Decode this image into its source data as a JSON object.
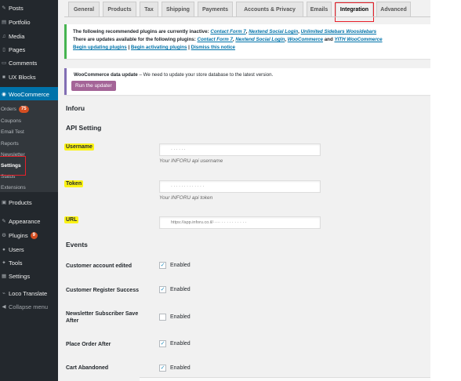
{
  "sidebar": {
    "items": [
      {
        "label": "Posts",
        "icon": "pin-icon"
      },
      {
        "label": "Portfolio",
        "icon": "portfolio-icon"
      },
      {
        "label": "Media",
        "icon": "media-icon"
      },
      {
        "label": "Pages",
        "icon": "pages-icon"
      },
      {
        "label": "Comments",
        "icon": "comments-icon"
      },
      {
        "label": "UX Blocks",
        "icon": "blocks-icon"
      },
      {
        "label": "WooCommerce",
        "icon": "woo-icon"
      },
      {
        "label": "Products",
        "icon": "products-icon"
      },
      {
        "label": "Appearance",
        "icon": "appearance-icon"
      },
      {
        "label": "Plugins",
        "icon": "plugins-icon",
        "badge": "9"
      },
      {
        "label": "Users",
        "icon": "users-icon"
      },
      {
        "label": "Tools",
        "icon": "tools-icon"
      },
      {
        "label": "Settings",
        "icon": "settings-icon"
      },
      {
        "label": "Loco Translate",
        "icon": "translate-icon"
      },
      {
        "label": "Collapse menu",
        "icon": "collapse-icon"
      }
    ],
    "sub_items": [
      {
        "label": "Orders",
        "badge": "75"
      },
      {
        "label": "Coupons"
      },
      {
        "label": "Email Test"
      },
      {
        "label": "Reports"
      },
      {
        "label": "Newsletter"
      },
      {
        "label": "Settings"
      },
      {
        "label": "Status"
      },
      {
        "label": "Extensions"
      }
    ]
  },
  "tabs": [
    "General",
    "Products",
    "Tax",
    "Shipping",
    "Payments",
    "Accounts & Privacy",
    "Emails",
    "Integration",
    "Advanced"
  ],
  "active_tab": "Integration",
  "notice_plugins": {
    "line1_prefix": "The following recommended plugins are currently inactive: ",
    "line1_links": [
      "Contact Form 7",
      "Nextend Social Login",
      "Unlimited Sidebars Woosidebars"
    ],
    "line2_prefix": "There are updates available for the following plugins: ",
    "line2_links": [
      "Contact Form 7",
      "Nextend Social Login",
      "WooCommerce",
      "YITH WooCommerce"
    ],
    "line3_links": [
      "Begin updating plugins",
      "Begin activating plugins",
      "Dismiss this notice"
    ],
    "sep": ", ",
    "and": " and ",
    "pipe": " | "
  },
  "notice_update": {
    "title": "WooCommerce data update",
    "message": " – We need to update your store database to the latest version.",
    "button": "Run the updater"
  },
  "section_title": "Inforu",
  "api_heading": "API Setting",
  "fields": {
    "username": {
      "label": "Username",
      "value": "· · · · · ·",
      "desc": "Your INFORU api username"
    },
    "token": {
      "label": "Token",
      "value": "· · · · ·          · · · · · · · ·",
      "desc": "Your INFORU api token"
    },
    "url": {
      "label": "URL",
      "value": "https://app.inforu.co.il/·····                · · ·  · ·  · · · · ·"
    }
  },
  "events_heading": "Events",
  "events": [
    {
      "label": "Customer account edited",
      "checked": true,
      "value": "Enabled"
    },
    {
      "label": "Customer Register Success",
      "checked": true,
      "value": "Enabled"
    },
    {
      "label": "Newsletter Subscriber Save After",
      "checked": false,
      "value": "Enabled"
    },
    {
      "label": "Place Order After",
      "checked": true,
      "value": "Enabled"
    },
    {
      "label": "Cart Abandoned",
      "checked": true,
      "value": "Enabled"
    }
  ],
  "colors": {
    "accent": "#0073aa",
    "highlight": "#fbf315",
    "annotation_red": "#e8202a",
    "woo_purple": "#a46497"
  }
}
